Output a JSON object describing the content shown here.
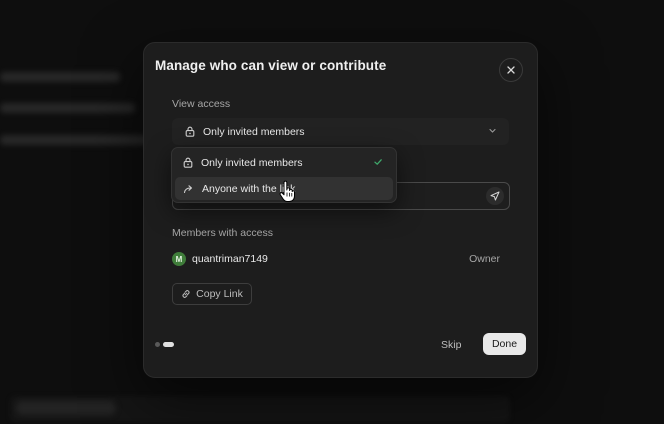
{
  "dialog": {
    "title": "Manage who can view or contribute",
    "view_access_label": "View access",
    "selected_option": "Only invited members",
    "members_label": "Members with access",
    "members": [
      {
        "avatar_letter": "M",
        "name": "quantriman7149",
        "role": "Owner"
      }
    ],
    "copy_link_label": "Copy Link",
    "skip_label": "Skip",
    "done_label": "Done",
    "pagination": {
      "current": 2,
      "total": 2
    }
  },
  "dropdown": {
    "options": [
      {
        "label": "Only invited members",
        "icon": "lock-icon",
        "selected": true
      },
      {
        "label": "Anyone with the link",
        "icon": "share-arrow-icon",
        "selected": false
      }
    ]
  },
  "colors": {
    "modal_bg": "#1d1d1d",
    "page_bg": "#0e0e0e",
    "check_green": "#3fa86b",
    "avatar_green": "#3f7d3a",
    "done_bg": "#e9e9e9"
  }
}
